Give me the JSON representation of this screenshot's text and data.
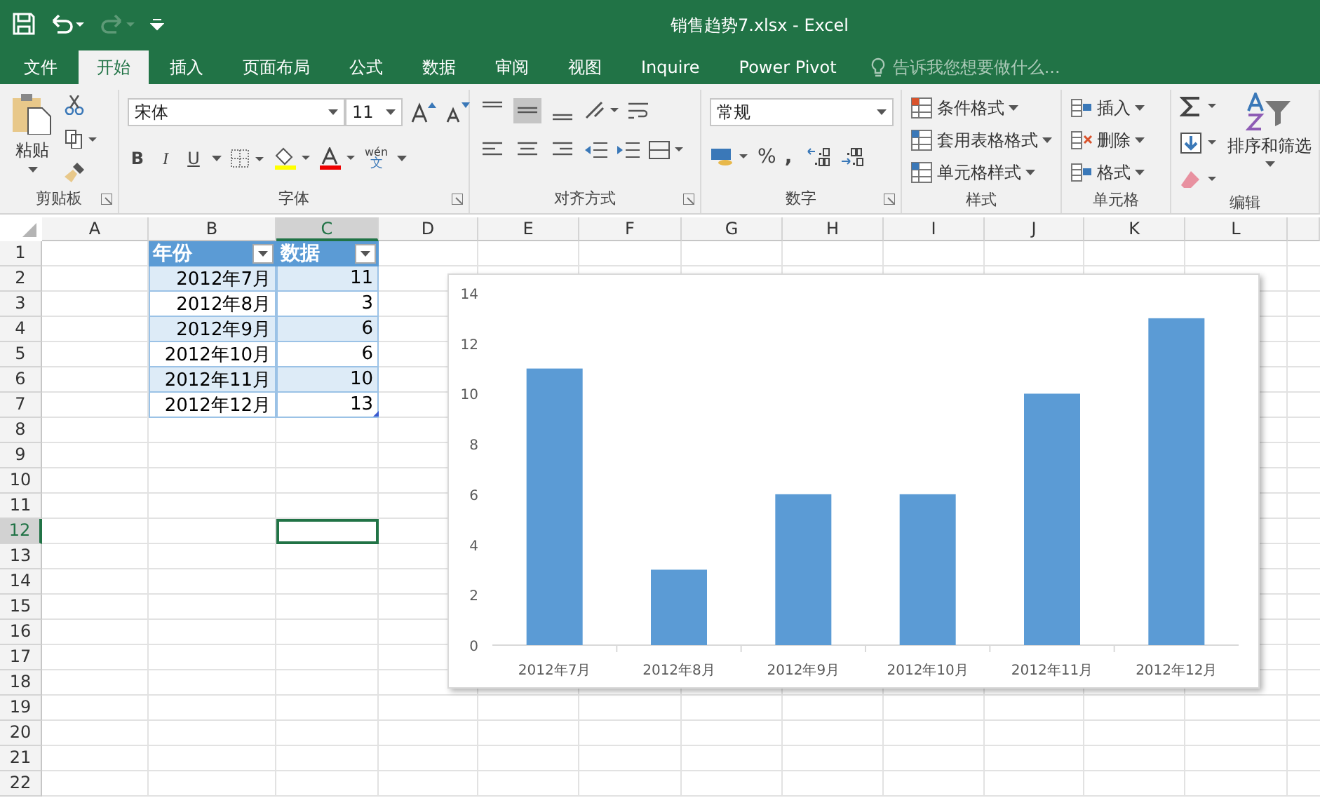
{
  "window": {
    "title": "销售趋势7.xlsx - Excel"
  },
  "tabs": [
    {
      "label": "文件",
      "selected": false
    },
    {
      "label": "开始",
      "selected": true
    },
    {
      "label": "插入",
      "selected": false
    },
    {
      "label": "页面布局",
      "selected": false
    },
    {
      "label": "公式",
      "selected": false
    },
    {
      "label": "数据",
      "selected": false
    },
    {
      "label": "审阅",
      "selected": false
    },
    {
      "label": "视图",
      "selected": false
    },
    {
      "label": "Inquire",
      "selected": false
    },
    {
      "label": "Power Pivot",
      "selected": false
    }
  ],
  "tell_me": {
    "placeholder": "告诉我您想要做什么..."
  },
  "ribbon": {
    "clipboard": {
      "paste": "粘贴",
      "label": "剪贴板"
    },
    "font": {
      "font_name": "宋体",
      "font_size": "11",
      "bold": "B",
      "italic": "I",
      "underline": "U",
      "phonetic_top": "wén",
      "phonetic_bottom": "文",
      "label": "字体"
    },
    "alignment": {
      "label": "对齐方式"
    },
    "number": {
      "format": "常规",
      "percent": "%",
      "comma": ",",
      "label": "数字"
    },
    "styles": {
      "items": [
        "条件格式",
        "套用表格格式",
        "单元格样式"
      ],
      "label": "样式"
    },
    "cells": {
      "items": [
        "插入",
        "删除",
        "格式"
      ],
      "label": "单元格"
    },
    "editing": {
      "sort": "排序和筛选",
      "label": "编辑"
    }
  },
  "sheet": {
    "columns": [
      {
        "label": "A",
        "selected": false
      },
      {
        "label": "B",
        "selected": false
      },
      {
        "label": "C",
        "selected": true
      },
      {
        "label": "D",
        "selected": false
      },
      {
        "label": "E",
        "selected": false
      },
      {
        "label": "F",
        "selected": false
      },
      {
        "label": "G",
        "selected": false
      },
      {
        "label": "H",
        "selected": false
      },
      {
        "label": "I",
        "selected": false
      },
      {
        "label": "J",
        "selected": false
      },
      {
        "label": "K",
        "selected": false
      },
      {
        "label": "L",
        "selected": false
      }
    ],
    "rows": [
      {
        "label": "1",
        "selected": false
      },
      {
        "label": "2",
        "selected": false
      },
      {
        "label": "3",
        "selected": false
      },
      {
        "label": "4",
        "selected": false
      },
      {
        "label": "5",
        "selected": false
      },
      {
        "label": "6",
        "selected": false
      },
      {
        "label": "7",
        "selected": false
      },
      {
        "label": "8",
        "selected": false
      },
      {
        "label": "9",
        "selected": false
      },
      {
        "label": "10",
        "selected": false
      },
      {
        "label": "11",
        "selected": false
      },
      {
        "label": "12",
        "selected": true
      },
      {
        "label": "13",
        "selected": false
      },
      {
        "label": "14",
        "selected": false
      },
      {
        "label": "15",
        "selected": false
      },
      {
        "label": "16",
        "selected": false
      },
      {
        "label": "17",
        "selected": false
      },
      {
        "label": "18",
        "selected": false
      },
      {
        "label": "19",
        "selected": false
      },
      {
        "label": "20",
        "selected": false
      },
      {
        "label": "21",
        "selected": false
      },
      {
        "label": "22",
        "selected": false
      }
    ],
    "table": {
      "headers": [
        "年份",
        "数据"
      ],
      "rows": [
        [
          "2012年7月",
          "11"
        ],
        [
          "2012年8月",
          "3"
        ],
        [
          "2012年9月",
          "6"
        ],
        [
          "2012年10月",
          "6"
        ],
        [
          "2012年11月",
          "10"
        ],
        [
          "2012年12月",
          "13"
        ]
      ]
    },
    "chart_data": {
      "type": "bar",
      "categories": [
        "2012年7月",
        "2012年8月",
        "2012年9月",
        "2012年10月",
        "2012年11月",
        "2012年12月"
      ],
      "series": [
        {
          "color": "#5b9bd5",
          "values": [
            11,
            3,
            6,
            6,
            10,
            13
          ]
        }
      ],
      "ylim": [
        0,
        14
      ],
      "yticks": [
        0,
        2,
        4,
        6,
        8,
        10,
        12,
        14
      ]
    }
  }
}
